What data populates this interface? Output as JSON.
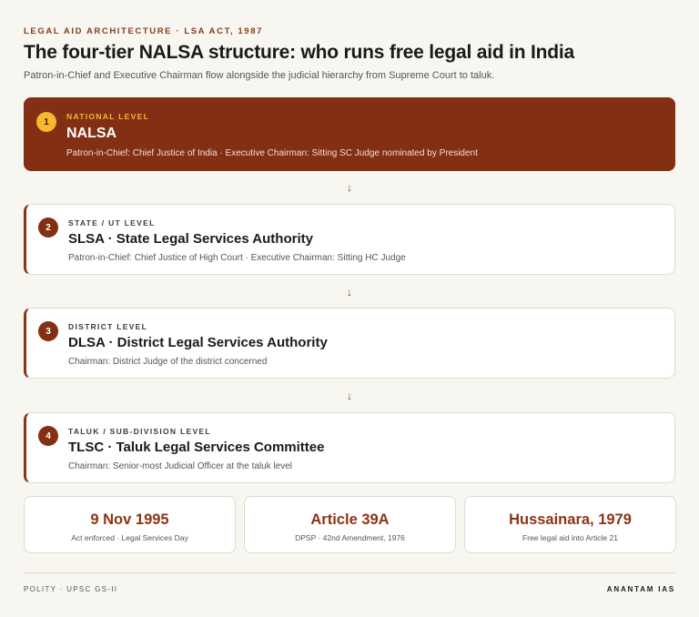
{
  "header": {
    "kicker": "LEGAL AID ARCHITECTURE · LSA ACT, 1987",
    "title": "The four-tier NALSA structure: who runs free legal aid in India",
    "subtitle": "Patron-in-Chief and Executive Chairman flow alongside the judicial hierarchy from Supreme Court to taluk."
  },
  "tiers": [
    {
      "number": "1",
      "level": "NATIONAL LEVEL",
      "name": "NALSA",
      "description": "Patron-in-Chief: Chief Justice of India · Executive Chairman: Sitting SC Judge nominated by President"
    },
    {
      "number": "2",
      "level": "STATE / UT LEVEL",
      "name": "SLSA · State Legal Services Authority",
      "description": "Patron-in-Chief: Chief Justice of High Court · Executive Chairman: Sitting HC Judge"
    },
    {
      "number": "3",
      "level": "DISTRICT LEVEL",
      "name": "DLSA · District Legal Services Authority",
      "description": "Chairman: District Judge of the district concerned"
    },
    {
      "number": "4",
      "level": "TALUK / SUB-DIVISION LEVEL",
      "name": "TLSC · Taluk Legal Services Committee",
      "description": "Chairman: Senior-most Judicial Officer at the taluk level"
    }
  ],
  "arrow_glyph": "↓",
  "facts": [
    {
      "value": "9 Nov 1995",
      "label": "Act enforced · Legal Services Day"
    },
    {
      "value": "Article 39A",
      "label": "DPSP · 42nd Amendment, 1976"
    },
    {
      "value": "Hussainara, 1979",
      "label": "Free legal aid into Article 21"
    }
  ],
  "footer": {
    "left": "POLITY · UPSC GS-II",
    "right": "ANANTAM IAS"
  },
  "colors": {
    "accent": "#832f13",
    "highlight": "#f5b82e",
    "background": "#f8f6f0"
  }
}
